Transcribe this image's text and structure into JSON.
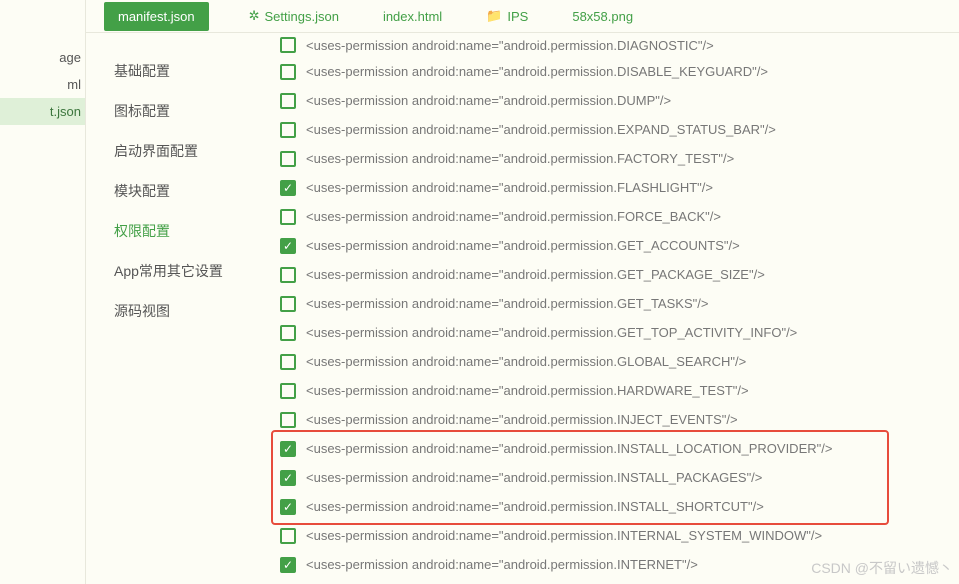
{
  "tree": {
    "items": [
      {
        "label": "age",
        "selected": false
      },
      {
        "label": "ml",
        "selected": false
      },
      {
        "label": "t.json",
        "selected": true
      }
    ]
  },
  "tabs": [
    {
      "label": "manifest.json",
      "icon": null,
      "active": true
    },
    {
      "label": "Settings.json",
      "icon": "gear",
      "active": false
    },
    {
      "label": "index.html",
      "icon": null,
      "active": false
    },
    {
      "label": "IPS",
      "icon": "folder",
      "active": false
    },
    {
      "label": "58x58.png",
      "icon": null,
      "active": false
    }
  ],
  "sidebar": {
    "items": [
      {
        "label": "基础配置",
        "selected": false
      },
      {
        "label": "图标配置",
        "selected": false
      },
      {
        "label": "启动界面配置",
        "selected": false
      },
      {
        "label": "模块配置",
        "selected": false
      },
      {
        "label": "权限配置",
        "selected": true
      },
      {
        "label": "App常用其它设置",
        "selected": false
      },
      {
        "label": "源码视图",
        "selected": false
      }
    ]
  },
  "permissions": [
    {
      "checked": false,
      "text": "<uses-permission android:name=\"android.permission.DIAGNOSTIC\"/>",
      "cut": true
    },
    {
      "checked": false,
      "text": "<uses-permission android:name=\"android.permission.DISABLE_KEYGUARD\"/>"
    },
    {
      "checked": false,
      "text": "<uses-permission android:name=\"android.permission.DUMP\"/>"
    },
    {
      "checked": false,
      "text": "<uses-permission android:name=\"android.permission.EXPAND_STATUS_BAR\"/>"
    },
    {
      "checked": false,
      "text": "<uses-permission android:name=\"android.permission.FACTORY_TEST\"/>"
    },
    {
      "checked": true,
      "text": "<uses-permission android:name=\"android.permission.FLASHLIGHT\"/>"
    },
    {
      "checked": false,
      "text": "<uses-permission android:name=\"android.permission.FORCE_BACK\"/>"
    },
    {
      "checked": true,
      "text": "<uses-permission android:name=\"android.permission.GET_ACCOUNTS\"/>"
    },
    {
      "checked": false,
      "text": "<uses-permission android:name=\"android.permission.GET_PACKAGE_SIZE\"/>"
    },
    {
      "checked": false,
      "text": "<uses-permission android:name=\"android.permission.GET_TASKS\"/>"
    },
    {
      "checked": false,
      "text": "<uses-permission android:name=\"android.permission.GET_TOP_ACTIVITY_INFO\"/>"
    },
    {
      "checked": false,
      "text": "<uses-permission android:name=\"android.permission.GLOBAL_SEARCH\"/>"
    },
    {
      "checked": false,
      "text": "<uses-permission android:name=\"android.permission.HARDWARE_TEST\"/>"
    },
    {
      "checked": false,
      "text": "<uses-permission android:name=\"android.permission.INJECT_EVENTS\"/>"
    },
    {
      "checked": true,
      "text": "<uses-permission android:name=\"android.permission.INSTALL_LOCATION_PROVIDER\"/>",
      "hl": true
    },
    {
      "checked": true,
      "text": "<uses-permission android:name=\"android.permission.INSTALL_PACKAGES\"/>",
      "hl": true
    },
    {
      "checked": true,
      "text": "<uses-permission android:name=\"android.permission.INSTALL_SHORTCUT\"/>",
      "hl": true
    },
    {
      "checked": false,
      "text": "<uses-permission android:name=\"android.permission.INTERNAL_SYSTEM_WINDOW\"/>"
    },
    {
      "checked": true,
      "text": "<uses-permission android:name=\"android.permission.INTERNET\"/>"
    }
  ],
  "watermark": "CSDN @不留い遗憾丶"
}
